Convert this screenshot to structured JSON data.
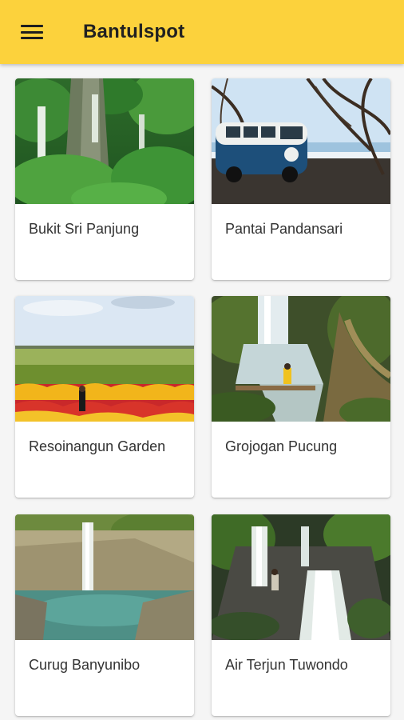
{
  "app": {
    "title": "Bantulspot",
    "menu_icon": "hamburger-menu-icon",
    "accent_color": "#fcd23c"
  },
  "places": [
    {
      "name": "Bukit Sri Panjung",
      "image": "waterfall-cliff-forest"
    },
    {
      "name": "Pantai Pandansari",
      "image": "vw-van-beach"
    },
    {
      "name": "Resoinangun Garden",
      "image": "flower-field-sky"
    },
    {
      "name": "Grojogan Pucung",
      "image": "forest-waterfall-stream"
    },
    {
      "name": "Curug Banyunibo",
      "image": "waterfall-pool-rocks"
    },
    {
      "name": "Air Terjun Tuwondo",
      "image": "cascading-waterfall-trees"
    }
  ]
}
